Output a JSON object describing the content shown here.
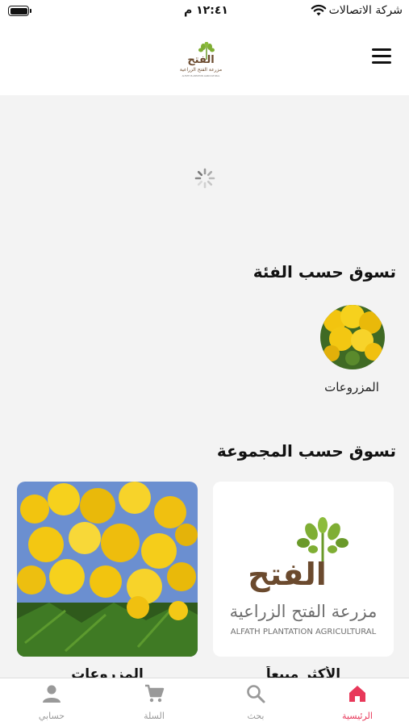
{
  "status_bar": {
    "carrier": "شركة الاتصالات",
    "time": "١٢:٤١ م"
  },
  "header": {
    "logo_text": "الفتح",
    "logo_subtitle": "مزرعة الفتح الزراعية",
    "logo_subtitle_en": "ALFATH PLANTATION AGRICULTURAL",
    "menu_icon": "hamburger-icon"
  },
  "categories_section": {
    "title": "تسوق حسب الفئة",
    "items": [
      {
        "label": "المزروعات"
      }
    ]
  },
  "groups_section": {
    "title": "تسوق حسب المجموعة",
    "cards": [
      {
        "caption": "الأكثر مبيعاً",
        "logo_word": "الفتح",
        "logo_line1": "مزرعة الفتح الزراعية",
        "logo_line2": "ALFATH PLANTATION AGRICULTURAL"
      },
      {
        "caption": "المزروعات"
      }
    ]
  },
  "bottom_nav": {
    "items": [
      {
        "label": "الرئيسية",
        "icon": "home-icon",
        "active": true
      },
      {
        "label": "بحث",
        "icon": "search-icon",
        "active": false
      },
      {
        "label": "السلة",
        "icon": "cart-icon",
        "active": false
      },
      {
        "label": "حسابي",
        "icon": "user-icon",
        "active": false
      }
    ]
  },
  "colors": {
    "accent": "#e8385a",
    "inactive": "#999999",
    "logo_brown": "#6b4a2e",
    "logo_green": "#6a9a2a",
    "background": "#f3f3f3"
  }
}
